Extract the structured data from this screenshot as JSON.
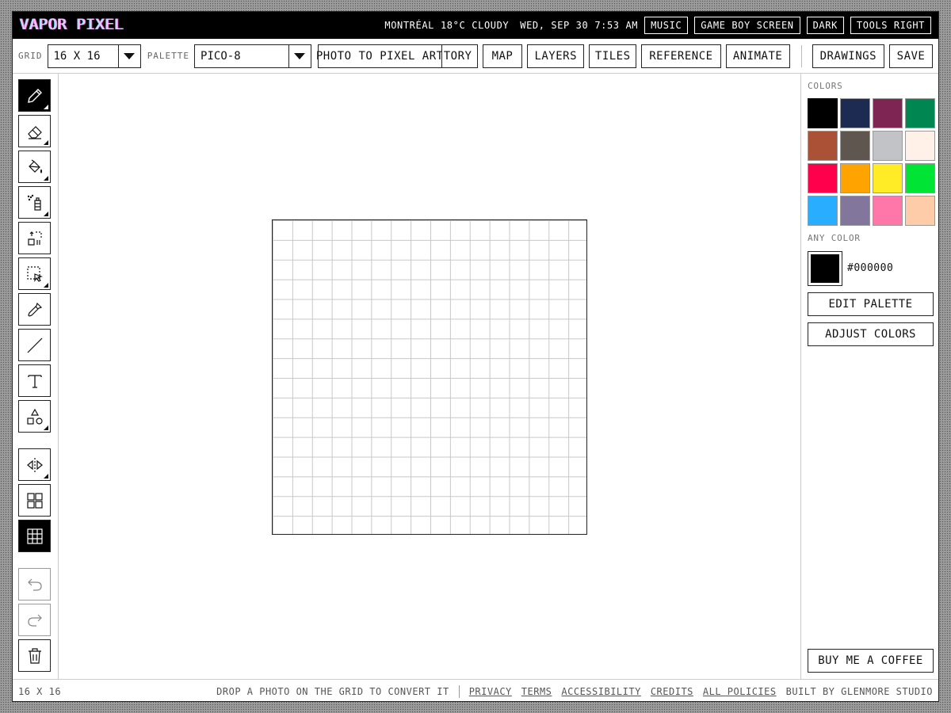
{
  "app": {
    "title": "VAPOR PIXEL"
  },
  "titlebar": {
    "city": "MONTRÉAL",
    "temp": "18°C",
    "weather": "CLOUDY",
    "date": "WED, SEP 30",
    "time": "7:53 AM",
    "buttons": [
      "MUSIC",
      "GAME BOY SCREEN",
      "DARK",
      "TOOLS RIGHT"
    ]
  },
  "toolbar": {
    "grid_label": "GRID",
    "grid_value": "16 X 16",
    "palette_label": "PALETTE",
    "palette_value": "PICO-8",
    "buttons": [
      "PHOTO TO PIXEL ART",
      "TORY",
      "MAP",
      "LAYERS",
      "TILES",
      "REFERENCE",
      "ANIMATE"
    ],
    "drawings_label": "DRAWINGS",
    "save_label": "SAVE"
  },
  "tools": [
    {
      "name": "pencil-tool",
      "icon": "pencil-icon",
      "active": true,
      "submenu": true
    },
    {
      "name": "eraser-tool",
      "icon": "eraser-icon",
      "active": false,
      "submenu": true
    },
    {
      "name": "fill-tool",
      "icon": "paint-bucket-icon",
      "active": false,
      "submenu": true
    },
    {
      "name": "spray-tool",
      "icon": "spray-can-icon",
      "active": false,
      "submenu": true
    },
    {
      "name": "move-tool",
      "icon": "move-selection-icon",
      "active": false,
      "submenu": false
    },
    {
      "name": "select-tool",
      "icon": "marquee-select-icon",
      "active": false,
      "submenu": true
    },
    {
      "name": "eyedropper-tool",
      "icon": "eyedropper-icon",
      "active": false,
      "submenu": false
    },
    {
      "name": "line-tool",
      "icon": "line-icon",
      "active": false,
      "submenu": false
    },
    {
      "name": "text-tool",
      "icon": "text-icon",
      "active": false,
      "submenu": false
    },
    {
      "name": "shapes-tool",
      "icon": "shapes-icon",
      "active": false,
      "submenu": true
    },
    {
      "name": "mirror-tool",
      "icon": "mirror-icon",
      "active": false,
      "submenu": true
    },
    {
      "name": "tile-view-tool",
      "icon": "tile-grid-icon",
      "active": false,
      "submenu": false
    },
    {
      "name": "grid-toggle-tool",
      "icon": "grid-icon",
      "active": true,
      "submenu": false
    },
    {
      "name": "undo-tool",
      "icon": "undo-icon",
      "active": false,
      "submenu": false
    },
    {
      "name": "redo-tool",
      "icon": "redo-icon",
      "active": false,
      "submenu": false
    },
    {
      "name": "clear-tool",
      "icon": "trash-icon",
      "active": false,
      "submenu": false
    }
  ],
  "colors": {
    "label": "COLORS",
    "swatches": [
      "#000000",
      "#1d2b53",
      "#7e2553",
      "#008751",
      "#ab5236",
      "#5f574f",
      "#c2c3c7",
      "#fff1e8",
      "#ff004d",
      "#ffa300",
      "#ffec27",
      "#00e436",
      "#29adff",
      "#83769c",
      "#ff77a8",
      "#ffccaa"
    ],
    "selected_index": 0,
    "any_color_label": "ANY COLOR",
    "current_hex": "#000000",
    "edit_palette_label": "EDIT PALETTE",
    "adjust_colors_label": "ADJUST COLORS",
    "coffee_label": "BUY ME A COFFEE"
  },
  "canvas": {
    "cols": 16,
    "rows": 16
  },
  "status": {
    "grid_size": "16 X 16",
    "hint": "DROP A PHOTO ON THE GRID TO CONVERT IT",
    "links": [
      "PRIVACY",
      "TERMS",
      "ACCESSIBILITY",
      "CREDITS",
      "ALL POLICIES"
    ],
    "built_by": "BUILT BY GLENMORE STUDIO"
  }
}
